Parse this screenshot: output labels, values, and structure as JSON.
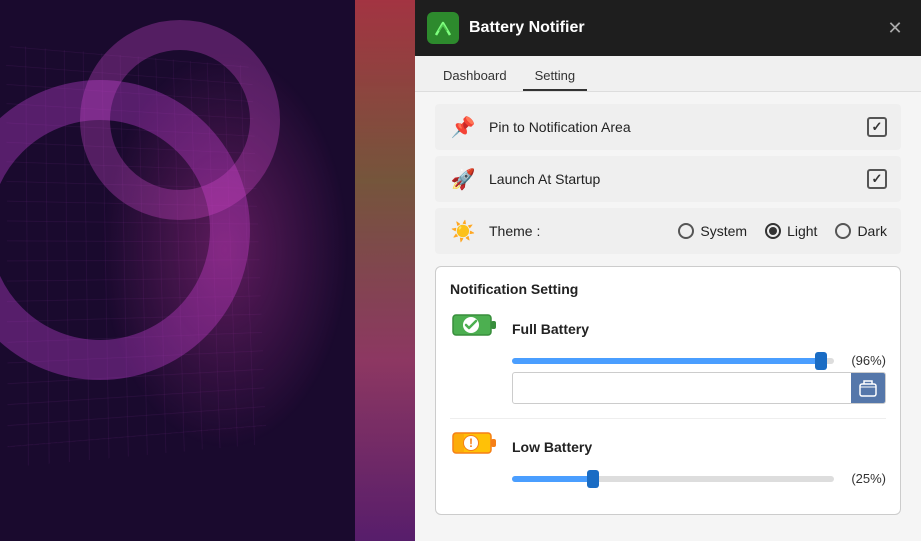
{
  "background": {
    "description": "Dark purple city lights background"
  },
  "window": {
    "title": "Battery Notifier",
    "icon": "🔋",
    "close_label": "✕"
  },
  "nav": {
    "tabs": [
      {
        "id": "dashboard",
        "label": "Dashboard"
      },
      {
        "id": "setting",
        "label": "Setting"
      }
    ],
    "active_tab": "setting"
  },
  "settings": {
    "pin_to_notification": {
      "label": "Pin to Notification Area",
      "icon": "📌",
      "checked": true
    },
    "launch_at_startup": {
      "label": "Launch At Startup",
      "icon": "🚀",
      "checked": true
    },
    "theme": {
      "label": "Theme :",
      "icon": "☀",
      "options": [
        {
          "id": "system",
          "label": "System",
          "selected": false
        },
        {
          "id": "light",
          "label": "Light",
          "selected": true
        },
        {
          "id": "dark",
          "label": "Dark",
          "selected": false
        }
      ]
    }
  },
  "notification_section": {
    "title": "Notification Setting",
    "full_battery": {
      "label": "Full Battery",
      "emoji": "🔋✅",
      "value": 96,
      "value_display": "(96%)"
    },
    "low_battery": {
      "label": "Low Battery",
      "emoji": "🔋⚠️",
      "value": 25,
      "value_display": "(25%)"
    }
  }
}
